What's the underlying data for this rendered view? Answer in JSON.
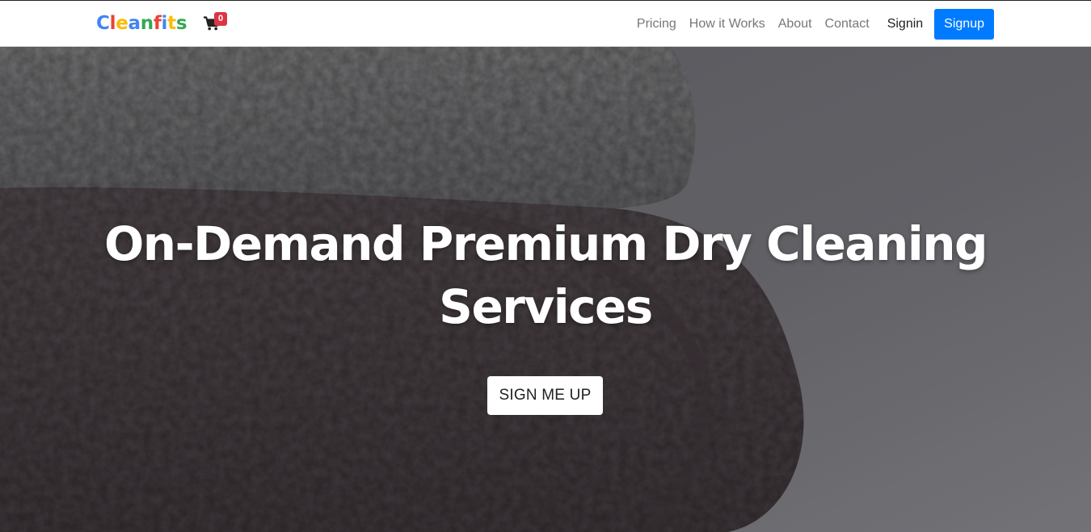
{
  "navbar": {
    "brand": [
      "C",
      "l",
      "e",
      "a",
      "n",
      "f",
      "i",
      "t",
      "s"
    ],
    "brand_colors": [
      "#4285f4",
      "#ea4335",
      "#fbbc05",
      "#4285f4",
      "#34a853",
      "#ea4335",
      "#4285f4",
      "#fbbc05",
      "#34a853"
    ],
    "cart_icon": "shopping-cart-icon",
    "cart_count": "0",
    "links": [
      "Pricing",
      "How it Works",
      "About",
      "Contact"
    ],
    "signin_label": "Signin",
    "signup_label": "Signup",
    "accent_color": "#007bff",
    "badge_color": "#dc3545"
  },
  "hero": {
    "title": "On-Demand Premium Dry Cleaning Services",
    "cta_label": "SIGN ME UP",
    "background": "stacked-towels-photo"
  }
}
